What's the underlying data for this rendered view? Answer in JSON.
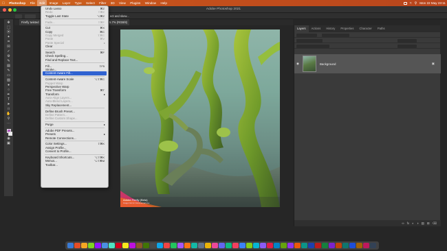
{
  "menubar": {
    "apple": "",
    "items": [
      "Photoshop",
      "File",
      "Edit",
      "Image",
      "Layer",
      "Type",
      "Select",
      "Filter",
      "3D",
      "View",
      "Plugins",
      "Window",
      "Help"
    ],
    "clock": "Mon 22 May 23:11"
  },
  "window": {
    "title": "Adobe Photoshop 2021"
  },
  "document": {
    "tab_label": "Firefly twisted",
    "tab_suffix": "ect and skew...",
    "zoom_info": "5.7% (RGB/8)"
  },
  "edit_menu": {
    "items": [
      {
        "label": "Undo Lasso",
        "shortcut": "⌘Z",
        "disabled": false
      },
      {
        "label": "Redo",
        "shortcut": "⇧⌘Z",
        "disabled": true
      },
      {
        "label": "Toggle Last State",
        "shortcut": "⌥⌘Z",
        "disabled": false
      },
      {
        "sep": true
      },
      {
        "label": "Fade...",
        "shortcut": "⇧⌘F",
        "disabled": true
      },
      {
        "sep": true
      },
      {
        "label": "Cut",
        "shortcut": "⌘X",
        "disabled": false
      },
      {
        "label": "Copy",
        "shortcut": "⌘C",
        "disabled": false
      },
      {
        "label": "Copy Merged",
        "shortcut": "⇧⌘C",
        "disabled": true
      },
      {
        "label": "Paste",
        "shortcut": "⌘V",
        "disabled": true
      },
      {
        "label": "Paste Special",
        "shortcut": "",
        "disabled": true,
        "submenu": true
      },
      {
        "label": "Clear",
        "shortcut": "",
        "disabled": false
      },
      {
        "sep": true
      },
      {
        "label": "Search",
        "shortcut": "⌘F",
        "disabled": false
      },
      {
        "label": "Check Spelling...",
        "shortcut": "",
        "disabled": false
      },
      {
        "label": "Find and Replace Text...",
        "shortcut": "",
        "disabled": false
      },
      {
        "sep": true
      },
      {
        "label": "Fill...",
        "shortcut": "⇧F5",
        "disabled": false
      },
      {
        "label": "Stroke...",
        "shortcut": "",
        "disabled": false
      },
      {
        "label": "Content-Aware Fill...",
        "shortcut": "",
        "disabled": false,
        "highlight": true
      },
      {
        "sep": true
      },
      {
        "label": "Content-Aware Scale",
        "shortcut": "⌥⇧⌘C",
        "disabled": false
      },
      {
        "label": "Puppet Warp",
        "shortcut": "",
        "disabled": true
      },
      {
        "label": "Perspective Warp",
        "shortcut": "",
        "disabled": false
      },
      {
        "label": "Free Transform",
        "shortcut": "⌘T",
        "disabled": false
      },
      {
        "label": "Transform",
        "shortcut": "",
        "disabled": false,
        "submenu": true
      },
      {
        "label": "Auto-Align Layers...",
        "shortcut": "",
        "disabled": true
      },
      {
        "label": "Auto-Blend Layers...",
        "shortcut": "",
        "disabled": true
      },
      {
        "label": "Sky Replacement...",
        "shortcut": "",
        "disabled": false
      },
      {
        "sep": true
      },
      {
        "label": "Define Brush Preset...",
        "shortcut": "",
        "disabled": false
      },
      {
        "label": "Define Pattern...",
        "shortcut": "",
        "disabled": true
      },
      {
        "label": "Define Custom Shape...",
        "shortcut": "",
        "disabled": true
      },
      {
        "sep": true
      },
      {
        "label": "Purge",
        "shortcut": "",
        "disabled": false,
        "submenu": true
      },
      {
        "sep": true
      },
      {
        "label": "Adobe PDF Presets...",
        "shortcut": "",
        "disabled": false
      },
      {
        "label": "Presets",
        "shortcut": "",
        "disabled": false,
        "submenu": true
      },
      {
        "label": "Remote Connections...",
        "shortcut": "",
        "disabled": false
      },
      {
        "sep": true
      },
      {
        "label": "Color Settings...",
        "shortcut": "⇧⌘K",
        "disabled": false
      },
      {
        "label": "Assign Profile...",
        "shortcut": "",
        "disabled": false
      },
      {
        "label": "Convert to Profile...",
        "shortcut": "",
        "disabled": false
      },
      {
        "sep": true
      },
      {
        "label": "Keyboard Shortcuts...",
        "shortcut": "⌥⇧⌘K",
        "disabled": false
      },
      {
        "label": "Menus...",
        "shortcut": "⌥⇧⌘M",
        "disabled": false
      },
      {
        "label": "Toolbar...",
        "shortcut": "",
        "disabled": false
      }
    ]
  },
  "panel": {
    "tabs": [
      "Layers",
      "Actions",
      "History",
      "Properties",
      "Character",
      "Paths"
    ],
    "active_tab": "Layers",
    "layer_name": "Background"
  },
  "artwork_badge": {
    "title": "Adobe Firefly (Beta)",
    "subtitle": "Image Not for Commercial Use"
  },
  "colors": {
    "menubar": "#c4501c",
    "highlight": "#2f62d1",
    "foreground_swatch": "#b25cc0"
  },
  "icons": [
    "apple-icon",
    "wifi-icon",
    "battery-icon",
    "search-icon",
    "eye-icon",
    "lock-icon",
    "trash-icon"
  ]
}
